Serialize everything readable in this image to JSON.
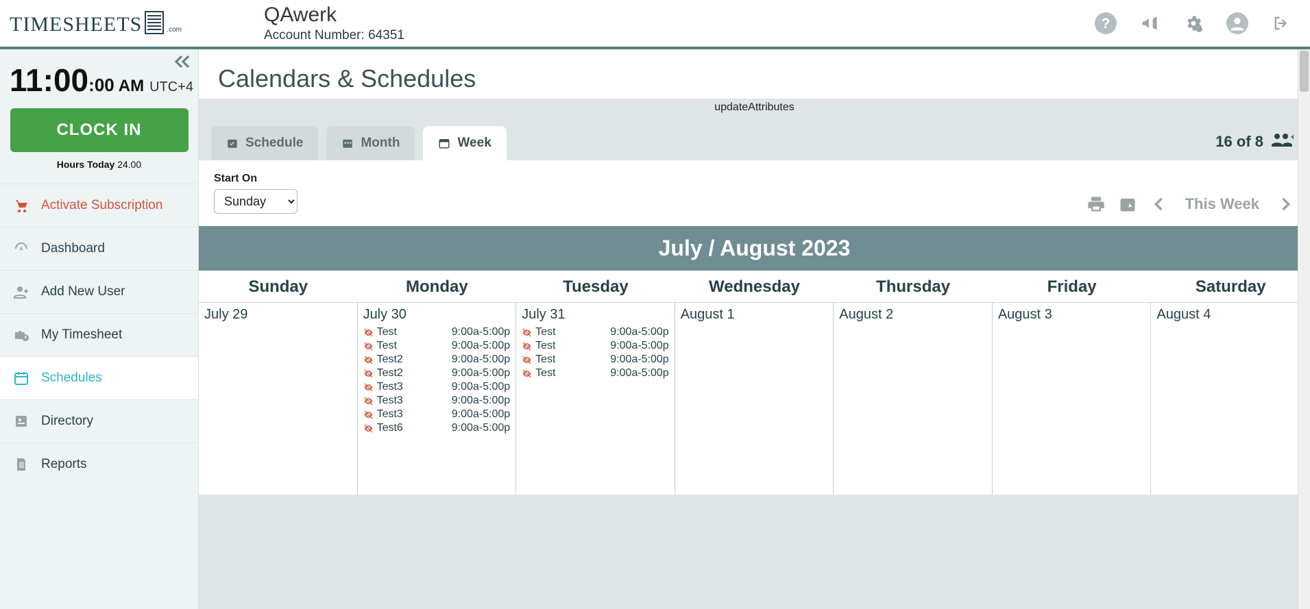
{
  "logo": {
    "text": "TIMESHEETS",
    "suffix": ".com"
  },
  "company": {
    "name": "QAwerk",
    "account_label": "Account Number:",
    "account_number": "64351"
  },
  "header_icons": [
    "help",
    "announce",
    "settings",
    "user",
    "logout"
  ],
  "clock": {
    "hh": "11",
    "mm": "00",
    "ss": "00",
    "ampm": "AM",
    "tz": "UTC+4"
  },
  "clockin_label": "CLOCK IN",
  "hours_today": {
    "label": "Hours Today",
    "value": "24.00"
  },
  "nav": {
    "activate": "Activate Subscription",
    "dashboard": "Dashboard",
    "add_user": "Add New User",
    "my_timesheet": "My Timesheet",
    "schedules": "Schedules",
    "directory": "Directory",
    "reports": "Reports"
  },
  "page_title": "Calendars & Schedules",
  "debug_text": "updateAttributes",
  "tabs": {
    "schedule": "Schedule",
    "month": "Month",
    "week": "Week"
  },
  "people_count": "16 of 8",
  "start_on": {
    "label": "Start On",
    "value": "Sunday"
  },
  "toolbar": {
    "this_week": "This Week"
  },
  "month_banner": "July / August 2023",
  "day_headers": [
    "Sunday",
    "Monday",
    "Tuesday",
    "Wednesday",
    "Thursday",
    "Friday",
    "Saturday"
  ],
  "days": [
    {
      "date": "July 29",
      "events": []
    },
    {
      "date": "July 30",
      "events": [
        {
          "name": "Test",
          "time": "9:00a-5:00p"
        },
        {
          "name": "Test",
          "time": "9:00a-5:00p"
        },
        {
          "name": "Test2",
          "time": "9:00a-5:00p"
        },
        {
          "name": "Test2",
          "time": "9:00a-5:00p"
        },
        {
          "name": "Test3",
          "time": "9:00a-5:00p"
        },
        {
          "name": "Test3",
          "time": "9:00a-5:00p"
        },
        {
          "name": "Test3",
          "time": "9:00a-5:00p"
        },
        {
          "name": "Test6",
          "time": "9:00a-5:00p"
        }
      ]
    },
    {
      "date": "July 31",
      "events": [
        {
          "name": "Test",
          "time": "9:00a-5:00p"
        },
        {
          "name": "Test",
          "time": "9:00a-5:00p"
        },
        {
          "name": "Test",
          "time": "9:00a-5:00p"
        },
        {
          "name": "Test",
          "time": "9:00a-5:00p"
        }
      ]
    },
    {
      "date": "August 1",
      "events": []
    },
    {
      "date": "August 2",
      "events": []
    },
    {
      "date": "August 3",
      "events": []
    },
    {
      "date": "August 4",
      "events": []
    }
  ]
}
